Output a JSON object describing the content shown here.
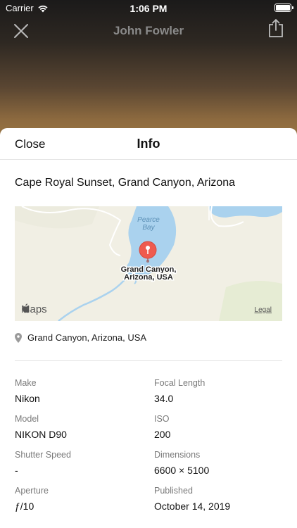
{
  "status_bar": {
    "carrier": "Carrier",
    "time": "1:06 PM"
  },
  "nav": {
    "title": "John Fowler",
    "close_icon": "close-icon",
    "share_icon": "share-icon"
  },
  "sheet": {
    "close_label": "Close",
    "title": "Info",
    "location_title": "Cape Royal Sunset, Grand Canyon, Arizona",
    "map": {
      "bay_label_line1": "Pearce",
      "bay_label_line2": "Bay",
      "pin_label_line1": "Grand Canyon,",
      "pin_label_line2": "Arizona, USA",
      "logo_text": "Maps",
      "legal": "Legal",
      "pin_color": "#ef5b4f",
      "water_color": "#aad2ee",
      "land_color": "#e6ecd4"
    },
    "location": "Grand Canyon, Arizona, USA",
    "exif": [
      {
        "label": "Make",
        "value": "Nikon"
      },
      {
        "label": "Focal Length",
        "value": "34.0"
      },
      {
        "label": "Model",
        "value": "NIKON D90"
      },
      {
        "label": "ISO",
        "value": "200"
      },
      {
        "label": "Shutter Speed",
        "value": "-"
      },
      {
        "label": "Dimensions",
        "value": "6600 × 5100"
      },
      {
        "label": "Aperture",
        "value": "ƒ/10"
      },
      {
        "label": "Published",
        "value": "October 14, 2019"
      }
    ]
  }
}
